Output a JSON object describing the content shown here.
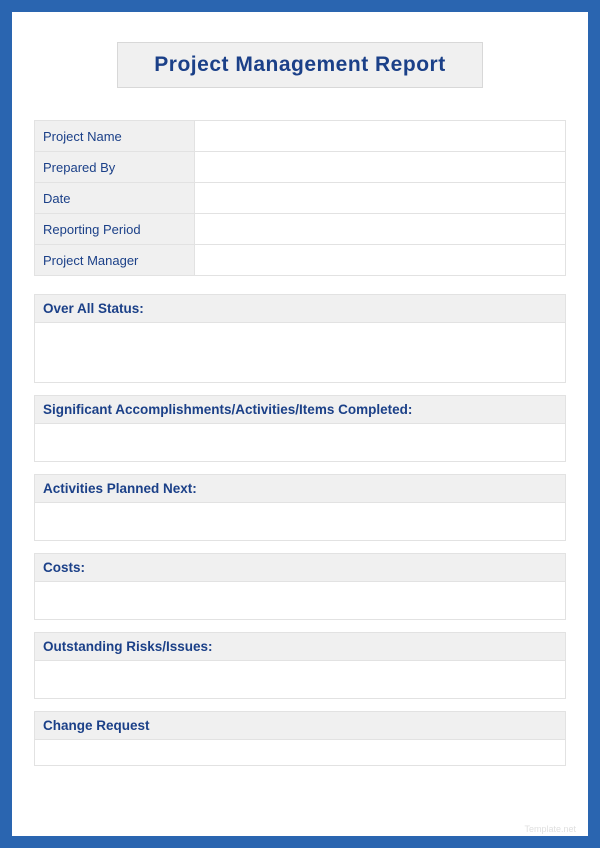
{
  "title": "Project Management Report",
  "info_rows": [
    {
      "label": "Project Name",
      "value": ""
    },
    {
      "label": "Prepared By",
      "value": ""
    },
    {
      "label": "Date",
      "value": ""
    },
    {
      "label": "Reporting Period",
      "value": ""
    },
    {
      "label": "Project Manager",
      "value": ""
    }
  ],
  "sections": {
    "overall_status": "Over All Status:",
    "accomplishments": "Significant Accomplishments/Activities/Items Completed:",
    "planned_next": "Activities Planned Next:",
    "costs": "Costs:",
    "risks": "Outstanding Risks/Issues:",
    "change_request": "Change Request"
  },
  "watermark": "Template.net"
}
